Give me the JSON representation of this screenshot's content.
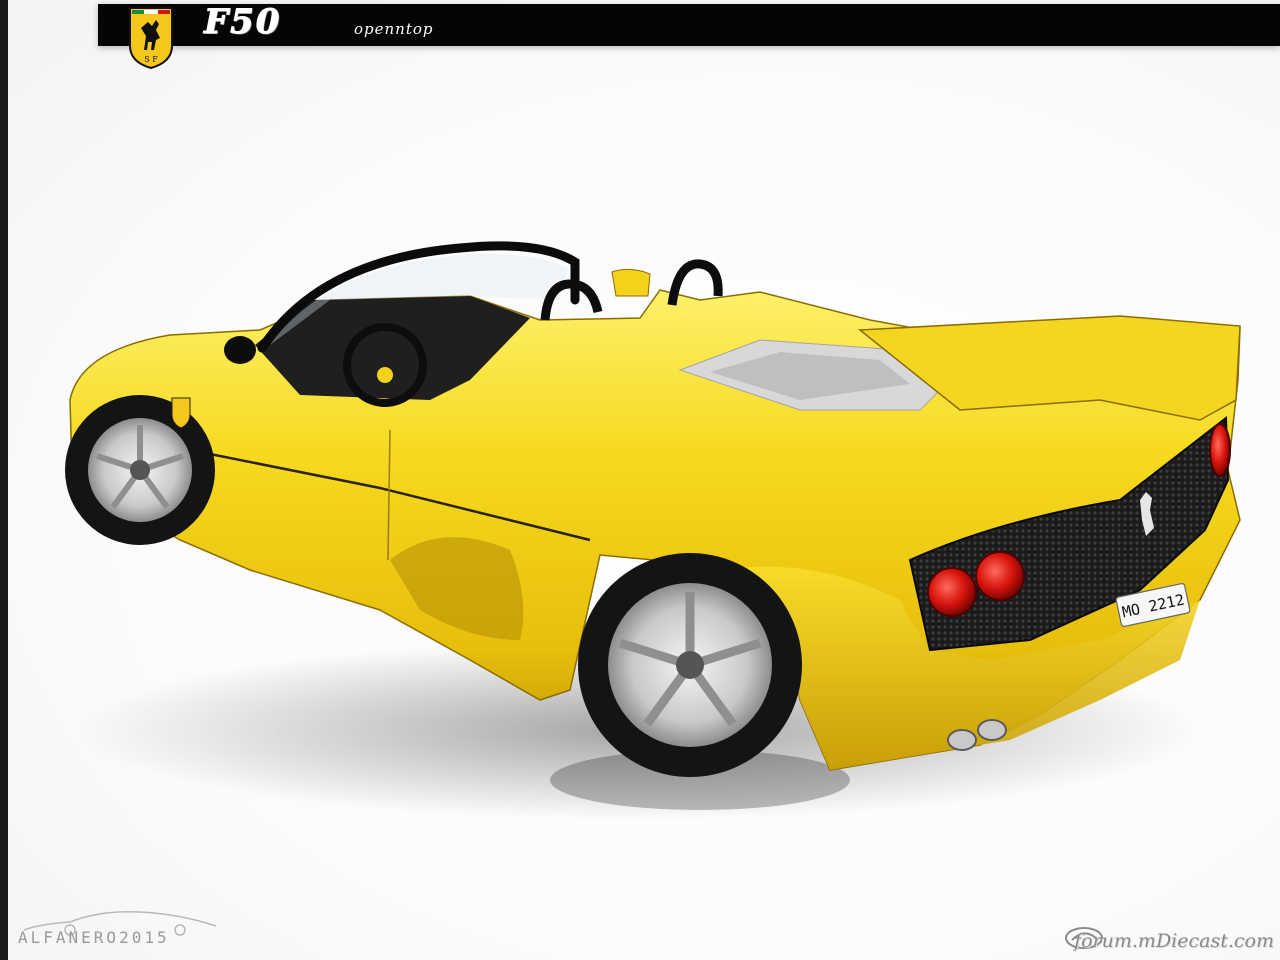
{
  "header": {
    "model": "F50",
    "variant": "openntop",
    "badge_icon": "prancing-horse-shield-icon"
  },
  "vehicle": {
    "plate": "MO 2212",
    "body_color": "#f2d21a",
    "taillight_color": "#d8130d"
  },
  "footer": {
    "credit": "ALFANERO2015",
    "site": "forum.mDiecast.com"
  },
  "colors": {
    "bar": "#050505",
    "shield_yellow": "#f4c71a"
  }
}
